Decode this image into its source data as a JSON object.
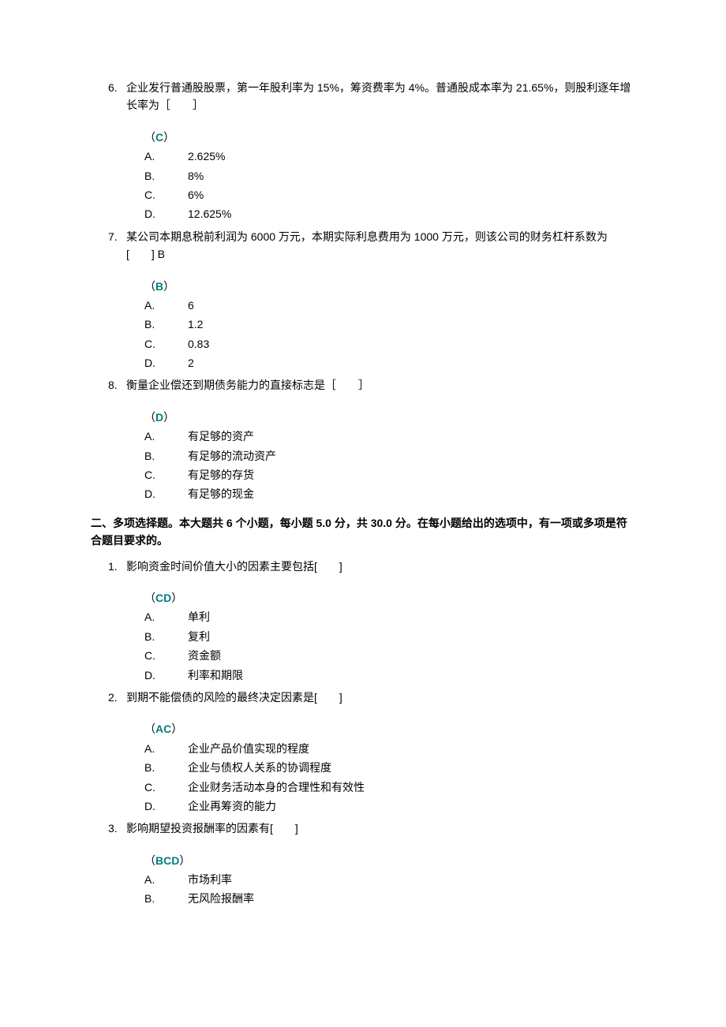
{
  "questions_part1": [
    {
      "num": "6.",
      "text": "企业发行普通股股票，第一年股利率为 15%，筹资费率为 4%。普通股成本率为 21.65%，则股利逐年增长率为［　　］",
      "answer": "C",
      "options": [
        {
          "letter": "A.",
          "text": "2.625%"
        },
        {
          "letter": "B.",
          "text": "8%"
        },
        {
          "letter": "C.",
          "text": "6%"
        },
        {
          "letter": "D.",
          "text": "12.625%"
        }
      ]
    },
    {
      "num": "7.",
      "text": "某公司本期息税前利润为 6000 万元，本期实际利息费用为 1000 万元，则该公司的财务杠杆系数为[　　] B",
      "answer": "B",
      "options": [
        {
          "letter": "A.",
          "text": "6"
        },
        {
          "letter": "B.",
          "text": "1.2"
        },
        {
          "letter": "C.",
          "text": "0.83"
        },
        {
          "letter": "D.",
          "text": "2"
        }
      ]
    },
    {
      "num": "8.",
      "text": "衡量企业偿还到期债务能力的直接标志是［　　］",
      "answer": "D",
      "options": [
        {
          "letter": "A.",
          "text": "有足够的资产"
        },
        {
          "letter": "B.",
          "text": "有足够的流动资产"
        },
        {
          "letter": "C.",
          "text": "有足够的存货"
        },
        {
          "letter": "D.",
          "text": "有足够的现金"
        }
      ]
    }
  ],
  "section2_header": {
    "prefix": "二、多项选择题。本大题共 ",
    "count": "6",
    "mid1": " 个小题，每小题 ",
    "points": "5.0",
    "mid2": " 分，共 ",
    "total": "30.0",
    "suffix": " 分。在每小题给出的选项中，有一项或多项是符合题目要求的。"
  },
  "questions_part2": [
    {
      "num": "1.",
      "text": "影响资金时间价值大小的因素主要包括[　　]",
      "answer": "CD",
      "options": [
        {
          "letter": "A.",
          "text": "单利"
        },
        {
          "letter": "B.",
          "text": "复利"
        },
        {
          "letter": "C.",
          "text": "资金额"
        },
        {
          "letter": "D.",
          "text": "利率和期限"
        }
      ]
    },
    {
      "num": "2.",
      "text": "到期不能偿债的风险的最终决定因素是[　　]",
      "answer": "AC",
      "options": [
        {
          "letter": "A.",
          "text": "企业产品价值实现的程度"
        },
        {
          "letter": "B.",
          "text": "企业与债权人关系的协调程度"
        },
        {
          "letter": "C.",
          "text": "企业财务活动本身的合理性和有效性"
        },
        {
          "letter": "D.",
          "text": "企业再筹资的能力"
        }
      ]
    },
    {
      "num": "3.",
      "text": "影响期望投资报酬率的因素有[　　]",
      "answer": "BCD",
      "options": [
        {
          "letter": "A.",
          "text": "市场利率"
        },
        {
          "letter": "B.",
          "text": "无风险报酬率"
        }
      ]
    }
  ]
}
